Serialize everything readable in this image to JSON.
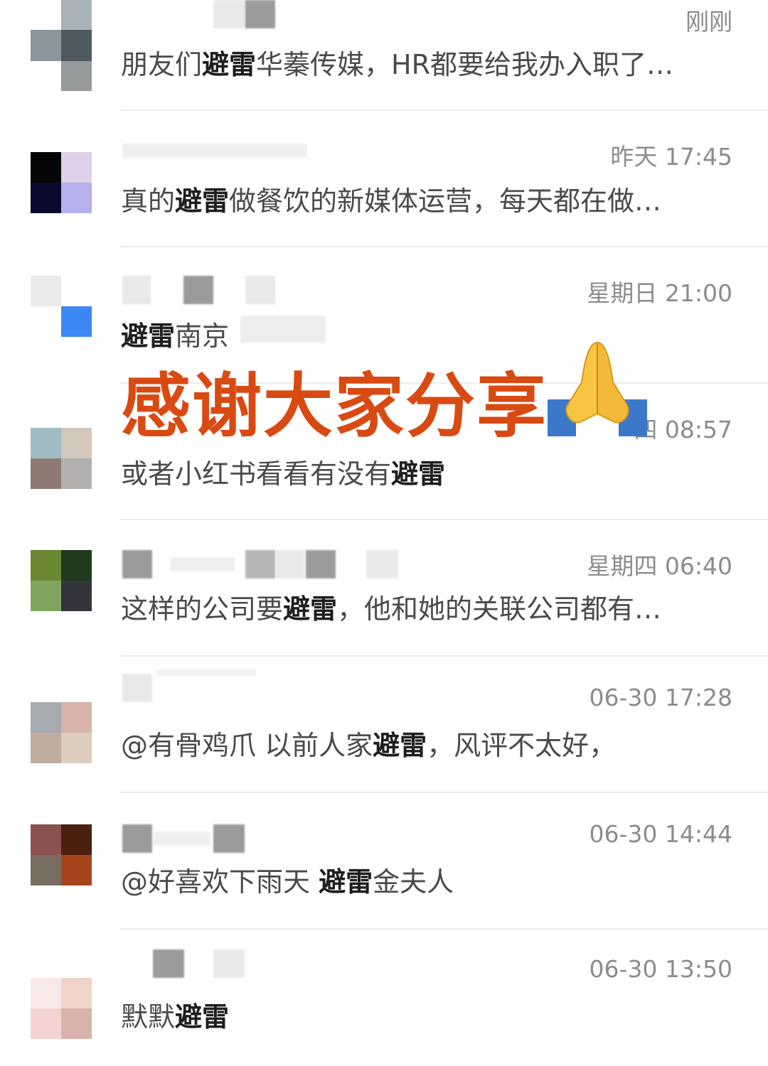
{
  "conversations": [
    {
      "time": "刚刚",
      "pre": "朋友们",
      "keyword": "避雷",
      "post": "华蓁传媒，HR都要给我办入职了…",
      "avatar_colors": [
        "#ffffff",
        "#a9b2b6",
        "#8a969c",
        "#4f5a61",
        "#ffffff",
        "#969a9b"
      ]
    },
    {
      "time": "昨天 17:45",
      "pre": "真的",
      "keyword": "避雷",
      "post": "做餐饮的新媒体运营，每天都在做…",
      "avatar_colors": [
        "#050508",
        "#e0cfe8",
        "#0b0a2e",
        "#b6b0ef"
      ]
    },
    {
      "time": "星期日 21:00",
      "pre": "",
      "keyword": "避雷",
      "post": "南京",
      "avatar_colors": [
        "#ebebeb",
        "#ffffff",
        "#ffffff",
        "#3d87f5"
      ]
    },
    {
      "time": "四 08:57",
      "pre": "或者小红书看看有没有",
      "keyword": "避雷",
      "post": "",
      "avatar_colors": [
        "#9fbcc5",
        "#d3c6ba",
        "#8e7a70",
        "#b2b0ae"
      ]
    },
    {
      "time": "星期四 06:40",
      "pre": "这样的公司要",
      "keyword": "避雷",
      "post": "，他和她的关联公司都有…",
      "avatar_colors": [
        "#6c8732",
        "#1f3a1c",
        "#7fa55e",
        "#33353a"
      ]
    },
    {
      "time": "06-30 17:28",
      "pre": "@有骨鸡爪 以前人家",
      "keyword": "避雷",
      "post": "，风评不太好，",
      "avatar_colors": [
        "#a8abb0",
        "#d7b3ab",
        "#c0ac9f",
        "#dccdbf"
      ]
    },
    {
      "time": "06-30 14:44",
      "pre": "@好喜欢下雨天 ",
      "keyword": "避雷",
      "post": "金夫人",
      "avatar_colors": [
        "#8c5250",
        "#4a200f",
        "#7a6e63",
        "#a8441c"
      ]
    },
    {
      "time": "06-30 13:50",
      "pre": "默默",
      "keyword": "避雷",
      "post": "",
      "avatar_colors": [
        "#f8e8e8",
        "#eed4c9",
        "#f3d2d0",
        "#d9b3ab"
      ]
    }
  ],
  "overlay": {
    "text": "感谢大家分享",
    "color": "#d94a12",
    "emoji": "folded-hands-icon"
  }
}
